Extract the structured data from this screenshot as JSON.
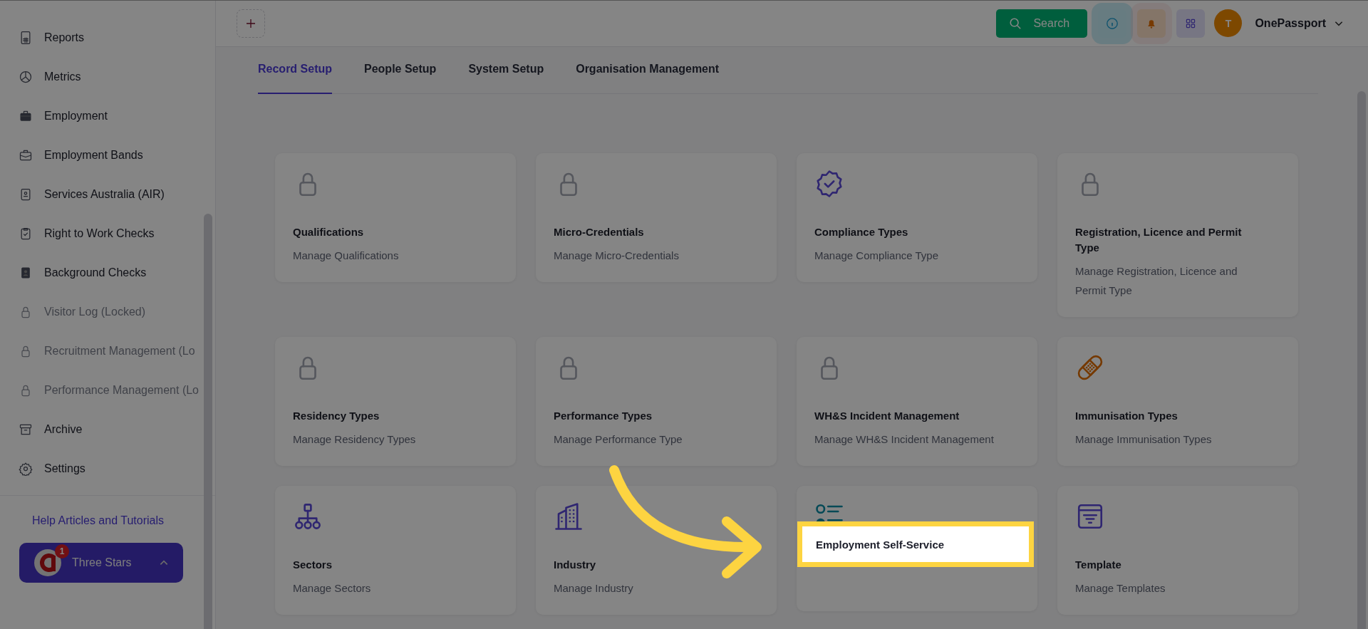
{
  "sidebar": {
    "items": [
      {
        "label": "Reports",
        "kind": "report",
        "locked": false
      },
      {
        "label": "Metrics",
        "kind": "pie",
        "locked": false
      },
      {
        "label": "Employment",
        "kind": "briefcase-solid",
        "locked": false
      },
      {
        "label": "Employment Bands",
        "kind": "briefcase",
        "locked": false
      },
      {
        "label": "Services Australia (AIR)",
        "kind": "id",
        "locked": false
      },
      {
        "label": "Right to Work Checks",
        "kind": "clipboard",
        "locked": false
      },
      {
        "label": "Background Checks",
        "kind": "badge",
        "locked": false
      },
      {
        "label": "Visitor Log (Locked)",
        "kind": "lock",
        "locked": true
      },
      {
        "label": "Recruitment Management (Lo",
        "kind": "lock",
        "locked": true
      },
      {
        "label": "Performance Management (Lo",
        "kind": "lock",
        "locked": true
      },
      {
        "label": "Archive",
        "kind": "archive",
        "locked": false
      },
      {
        "label": "Settings",
        "kind": "gear",
        "locked": false
      }
    ],
    "help_link": "Help Articles and Tutorials",
    "account": {
      "name": "Three Stars",
      "badge": "1"
    }
  },
  "topbar": {
    "search": "Search",
    "user_initial": "T",
    "user_name": "OnePassport"
  },
  "tabs": [
    {
      "label": "Record Setup",
      "selected": true
    },
    {
      "label": "People Setup",
      "selected": false
    },
    {
      "label": "System Setup",
      "selected": false
    },
    {
      "label": "Organisation Management",
      "selected": false
    }
  ],
  "cards": [
    {
      "kind": "lock",
      "title": "Qualifications",
      "description": "Manage Qualifications"
    },
    {
      "kind": "lock",
      "title": "Micro-Credentials",
      "description": "Manage Micro-Credentials"
    },
    {
      "kind": "verified",
      "title": "Compliance Types",
      "description": "Manage Compliance Type"
    },
    {
      "kind": "lock",
      "title": "Registration, Licence and Permit Type",
      "description": "Manage Registration, Licence and Permit Type"
    },
    {
      "kind": "lock",
      "title": "Residency Types",
      "description": "Manage Residency Types"
    },
    {
      "kind": "lock",
      "title": "Performance Types",
      "description": "Manage Performance Type"
    },
    {
      "kind": "lock",
      "title": "WH&S Incident Management",
      "description": "Manage WH&S Incident Management"
    },
    {
      "kind": "bandage",
      "title": "Immunisation Types",
      "description": "Manage Immunisation Types"
    },
    {
      "kind": "hierarchy",
      "title": "Sectors",
      "description": "Manage Sectors"
    },
    {
      "kind": "building",
      "title": "Industry",
      "description": "Manage Industry"
    },
    {
      "kind": "list"
    },
    {
      "kind": "template",
      "title": "Template",
      "description": "Manage Templates"
    }
  ],
  "highlight": {
    "text": "Employment Self-Service"
  }
}
